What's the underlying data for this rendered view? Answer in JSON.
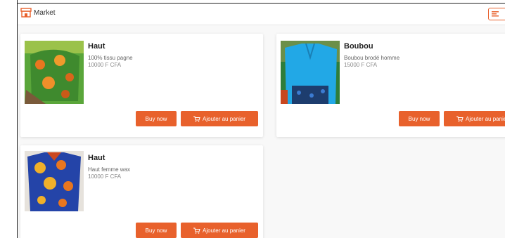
{
  "header": {
    "logo_text": "Market"
  },
  "products": [
    {
      "title": "Haut",
      "description": "100% tissu pagne",
      "price": "10000 F CFA",
      "buy_label": "Buy now",
      "cart_label": "Ajouter au panier"
    },
    {
      "title": "Boubou",
      "description": "Boubou brodé homme",
      "price": "15000 F CFA",
      "buy_label": "Buy now",
      "cart_label": "Ajouter au panier"
    },
    {
      "title": "Haut",
      "description": "Haut femme wax",
      "price": "10000 F CFA",
      "buy_label": "Buy now",
      "cart_label": "Ajouter au panier"
    }
  ],
  "colors": {
    "accent": "#e8612c"
  }
}
